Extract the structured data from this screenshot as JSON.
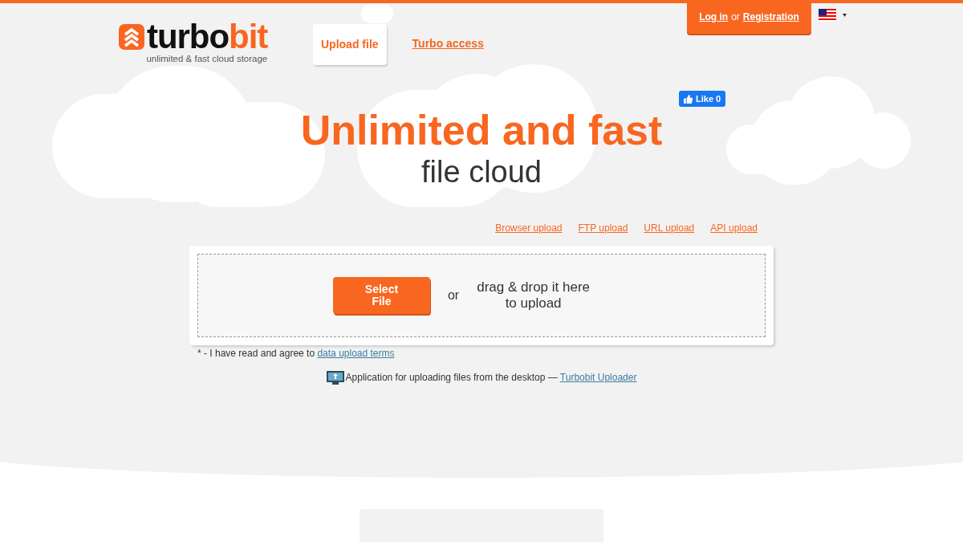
{
  "logo": {
    "word_dark": "turbo",
    "word_accent": "bit",
    "tagline": "unlimited & fast cloud storage"
  },
  "nav_tabs": [
    {
      "label": "Upload file",
      "selected": true
    },
    {
      "label": "Turbo access",
      "selected": false
    }
  ],
  "account": {
    "login": "Log in",
    "separator": "or",
    "register": "Registration"
  },
  "facebook_like": {
    "label": "Like 0"
  },
  "hero": {
    "title": "Unlimited and fast",
    "subtitle": "file cloud"
  },
  "upload_methods": [
    "Browser upload",
    "FTP upload",
    "URL upload",
    "API upload"
  ],
  "upload_box": {
    "button": "Select\nFile",
    "or": "or",
    "hint": "drag & drop it here\nto upload"
  },
  "terms": {
    "text": "* - I have read and agree to ",
    "link": "data upload terms"
  },
  "desktop_app": {
    "text": "Application for uploading files from the desktop — ",
    "link": "Turbobit Uploader"
  }
}
